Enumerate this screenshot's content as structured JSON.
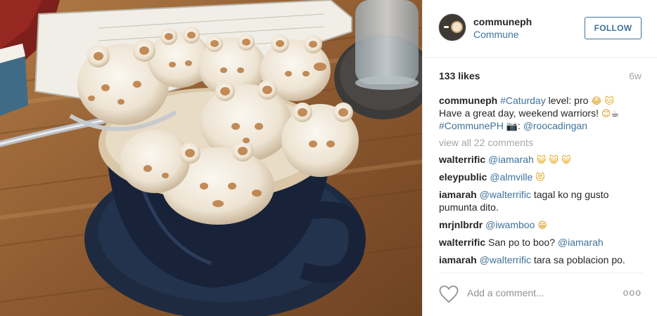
{
  "post": {
    "owner": {
      "username": "communeph",
      "full_name": "Commune"
    },
    "follow_label": "FOLLOW",
    "likes": "133 likes",
    "age": "6w",
    "caption": {
      "user": "communeph",
      "hashtag1": "#Caturday",
      "text1": " level: pro ",
      "emoji1": "😂",
      "emoji2": "🐱",
      "text2": "Have a great day, weekend warriors! ",
      "emoji3": "😊",
      "emoji4": "☕",
      "hashtag2": "#CommunePH",
      "emoji5": "📷",
      "text3": ": ",
      "mention": "@roocadingan"
    },
    "view_all": "view all 22 comments",
    "comments": [
      {
        "user": "walterrific",
        "mention": "@iamarah",
        "text": " ",
        "emoji": "😺 😺 😺"
      },
      {
        "user": "eleypublic",
        "mention": "@almville",
        "text": " ",
        "emoji": "😻"
      },
      {
        "user": "iamarah",
        "mention": "@walterrific",
        "text": " tagal ko ng gusto pumunta dito.",
        "emoji": ""
      },
      {
        "user": "mrjnlbrdr",
        "mention": "@iwamboo",
        "text": " ",
        "emoji": "😁"
      },
      {
        "user": "walterrific",
        "mention": "",
        "text": "San po to boo? ",
        "mention2": "@iamarah",
        "emoji": ""
      },
      {
        "user": "iamarah",
        "mention": "@walterrific",
        "text": " tara sa poblacion po.",
        "emoji": ""
      }
    ],
    "add_comment_placeholder": "Add a comment...",
    "more_label": "ooo"
  },
  "photo": {
    "subject": "3D latte art of foam cats in a dark blue cup on a wooden table"
  },
  "colors": {
    "link": "#3f729b",
    "muted": "#a5a7aa",
    "text": "#262626"
  },
  "icons": [
    "heart-icon",
    "more-options-icon",
    "avatar-logo"
  ]
}
